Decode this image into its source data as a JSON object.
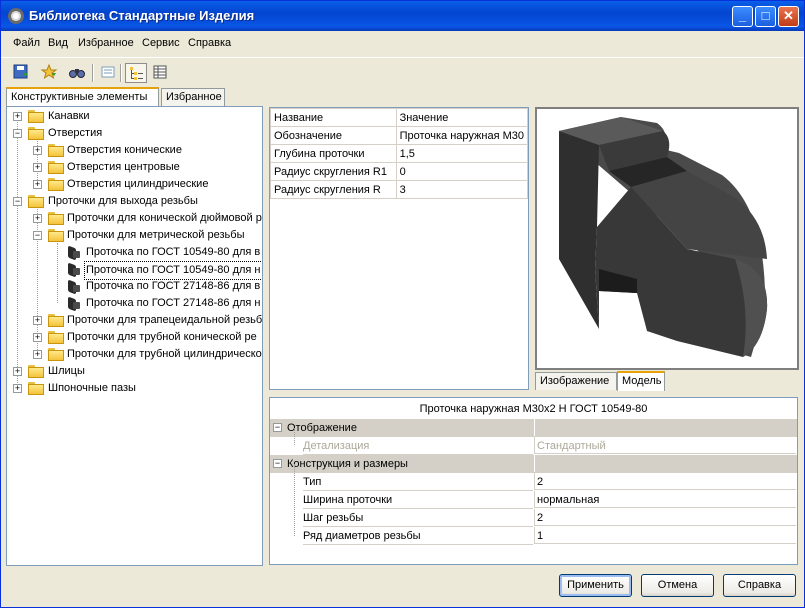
{
  "window": {
    "title": "Библиотека Стандартные Изделия",
    "minimize_glyph": "_",
    "maximize_glyph": "□",
    "close_glyph": "✕"
  },
  "menu": [
    "Файл",
    "Вид",
    "Избранное",
    "Сервис",
    "Справка"
  ],
  "toolbar": {
    "icons": [
      "save-icon",
      "add-favorite-icon",
      "search-binoculars-icon",
      "list-view-icon",
      "tree-view-icon",
      "table-view-icon"
    ]
  },
  "left_tabs": [
    "Конструктивные элементы",
    "Избранное"
  ],
  "tree": [
    {
      "label": "Канавки",
      "expander": "+"
    },
    {
      "label": "Отверстия",
      "expander": "−"
    },
    {
      "label": "Отверстия конические",
      "expander": "+"
    },
    {
      "label": "Отверстия центровые",
      "expander": "+"
    },
    {
      "label": "Отверстия цилиндрические",
      "expander": "+"
    },
    {
      "label": "Проточки для выхода резьбы",
      "expander": "−"
    },
    {
      "label": "Проточки для конической дюймовой р",
      "expander": "+"
    },
    {
      "label": "Проточки для метрической резьбы",
      "expander": "−"
    },
    {
      "label": "Проточка по ГОСТ 10549-80 для в"
    },
    {
      "label": "Проточка по ГОСТ 10549-80 для н"
    },
    {
      "label": "Проточка по ГОСТ 27148-86 для в"
    },
    {
      "label": "Проточка по ГОСТ 27148-86 для н"
    },
    {
      "label": "Проточки для трапецеидальной резьб",
      "expander": "+"
    },
    {
      "label": "Проточки для трубной конической ре",
      "expander": "+"
    },
    {
      "label": "Проточки для трубной цилиндрическо",
      "expander": "+"
    },
    {
      "label": "Шлицы",
      "expander": "+"
    },
    {
      "label": "Шпоночные пазы",
      "expander": "+"
    }
  ],
  "params_table": {
    "headers": [
      "Название",
      "Значение"
    ],
    "rows": [
      [
        "Обозначение",
        "Проточка наружная М30"
      ],
      [
        "Глубина проточки",
        "1,5"
      ],
      [
        "Радиус скругления R1",
        "0"
      ],
      [
        "Радиус скругления R",
        "3"
      ]
    ]
  },
  "preview_tabs": [
    "Изображение",
    "Модель"
  ],
  "properties": {
    "title": "Проточка наружная М30x2 Н ГОСТ 10549-80",
    "groups": [
      {
        "label": "Отображение",
        "expander": "−",
        "rows": [
          [
            "Детализация",
            "Стандартный"
          ]
        ]
      },
      {
        "label": "Конструкция и размеры",
        "expander": "−",
        "rows": [
          [
            "Тип",
            "2"
          ],
          [
            "Ширина проточки",
            "нормальная"
          ],
          [
            "Шаг резьбы",
            "2"
          ],
          [
            "Ряд диаметров резьбы",
            "1"
          ]
        ]
      }
    ]
  },
  "buttons": {
    "apply": "Применить",
    "cancel": "Отмена",
    "help": "Справка"
  }
}
